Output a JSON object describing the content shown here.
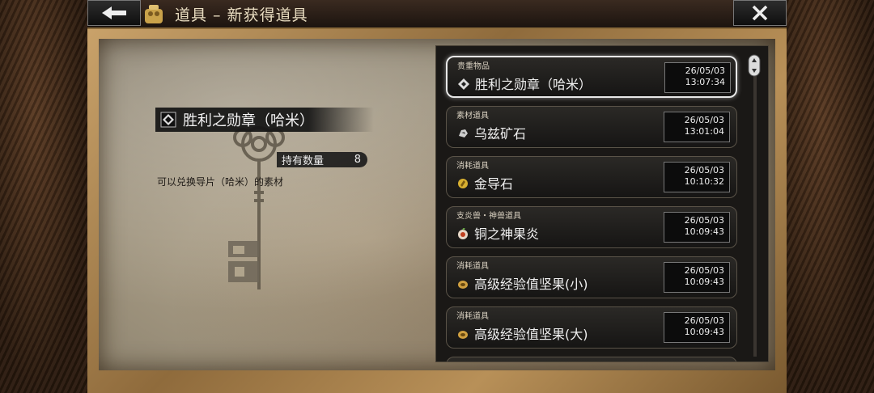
{
  "window": {
    "title": "道具 – 新获得道具"
  },
  "detail": {
    "name": "胜利之勋章（哈米）",
    "qty_label": "持有数量",
    "qty_value": "8",
    "description": "可以兑换导片（哈米）的素材"
  },
  "list": [
    {
      "category": "贵重物品",
      "name": "胜利之勋章（哈米）",
      "date": "26/05/03",
      "time": "13:07:34",
      "icon": "diamond-icon",
      "selected": true
    },
    {
      "category": "素材道具",
      "name": "乌兹矿石",
      "date": "26/05/03",
      "time": "13:01:04",
      "icon": "ore-icon"
    },
    {
      "category": "消耗道具",
      "name": "金导石",
      "date": "26/05/03",
      "time": "10:10:32",
      "icon": "gold-stone-icon"
    },
    {
      "category": "支炎兽・神兽道具",
      "name": "铜之神果炎",
      "date": "26/05/03",
      "time": "10:09:43",
      "icon": "fruit-icon"
    },
    {
      "category": "消耗道具",
      "name": "高级经验值坚果(小)",
      "date": "26/05/03",
      "time": "10:09:43",
      "icon": "nut-icon"
    },
    {
      "category": "消耗道具",
      "name": "高级经验值坚果(大)",
      "date": "26/05/03",
      "time": "10:09:43",
      "icon": "nut-icon"
    }
  ],
  "colors": {
    "accent": "#e8dcc0",
    "panel": "#1a1816",
    "parchment": "#b8ab92"
  }
}
